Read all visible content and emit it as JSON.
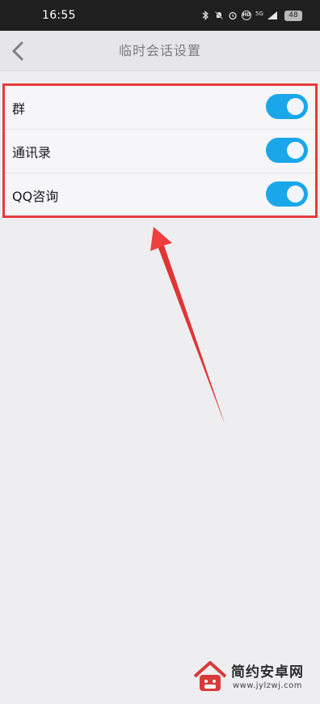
{
  "status_bar": {
    "time": "16:55",
    "battery": "48",
    "icons": [
      "bluetooth-icon",
      "mute-icon",
      "alarm-icon",
      "hd-icon",
      "signal-5g-icon",
      "signal-bars-icon"
    ]
  },
  "nav": {
    "title": "临时会话设置",
    "back_icon": "chevron-left-icon"
  },
  "settings": [
    {
      "label": "群",
      "enabled": true
    },
    {
      "label": "通讯录",
      "enabled": true
    },
    {
      "label": "QQ咨询",
      "enabled": true
    }
  ],
  "colors": {
    "toggle_on": "#19a7ea",
    "highlight_border": "#e53c3c",
    "arrow": "#ee4040"
  },
  "watermark": {
    "brand": "简约安卓网",
    "url": "www.jylzwj.com"
  }
}
